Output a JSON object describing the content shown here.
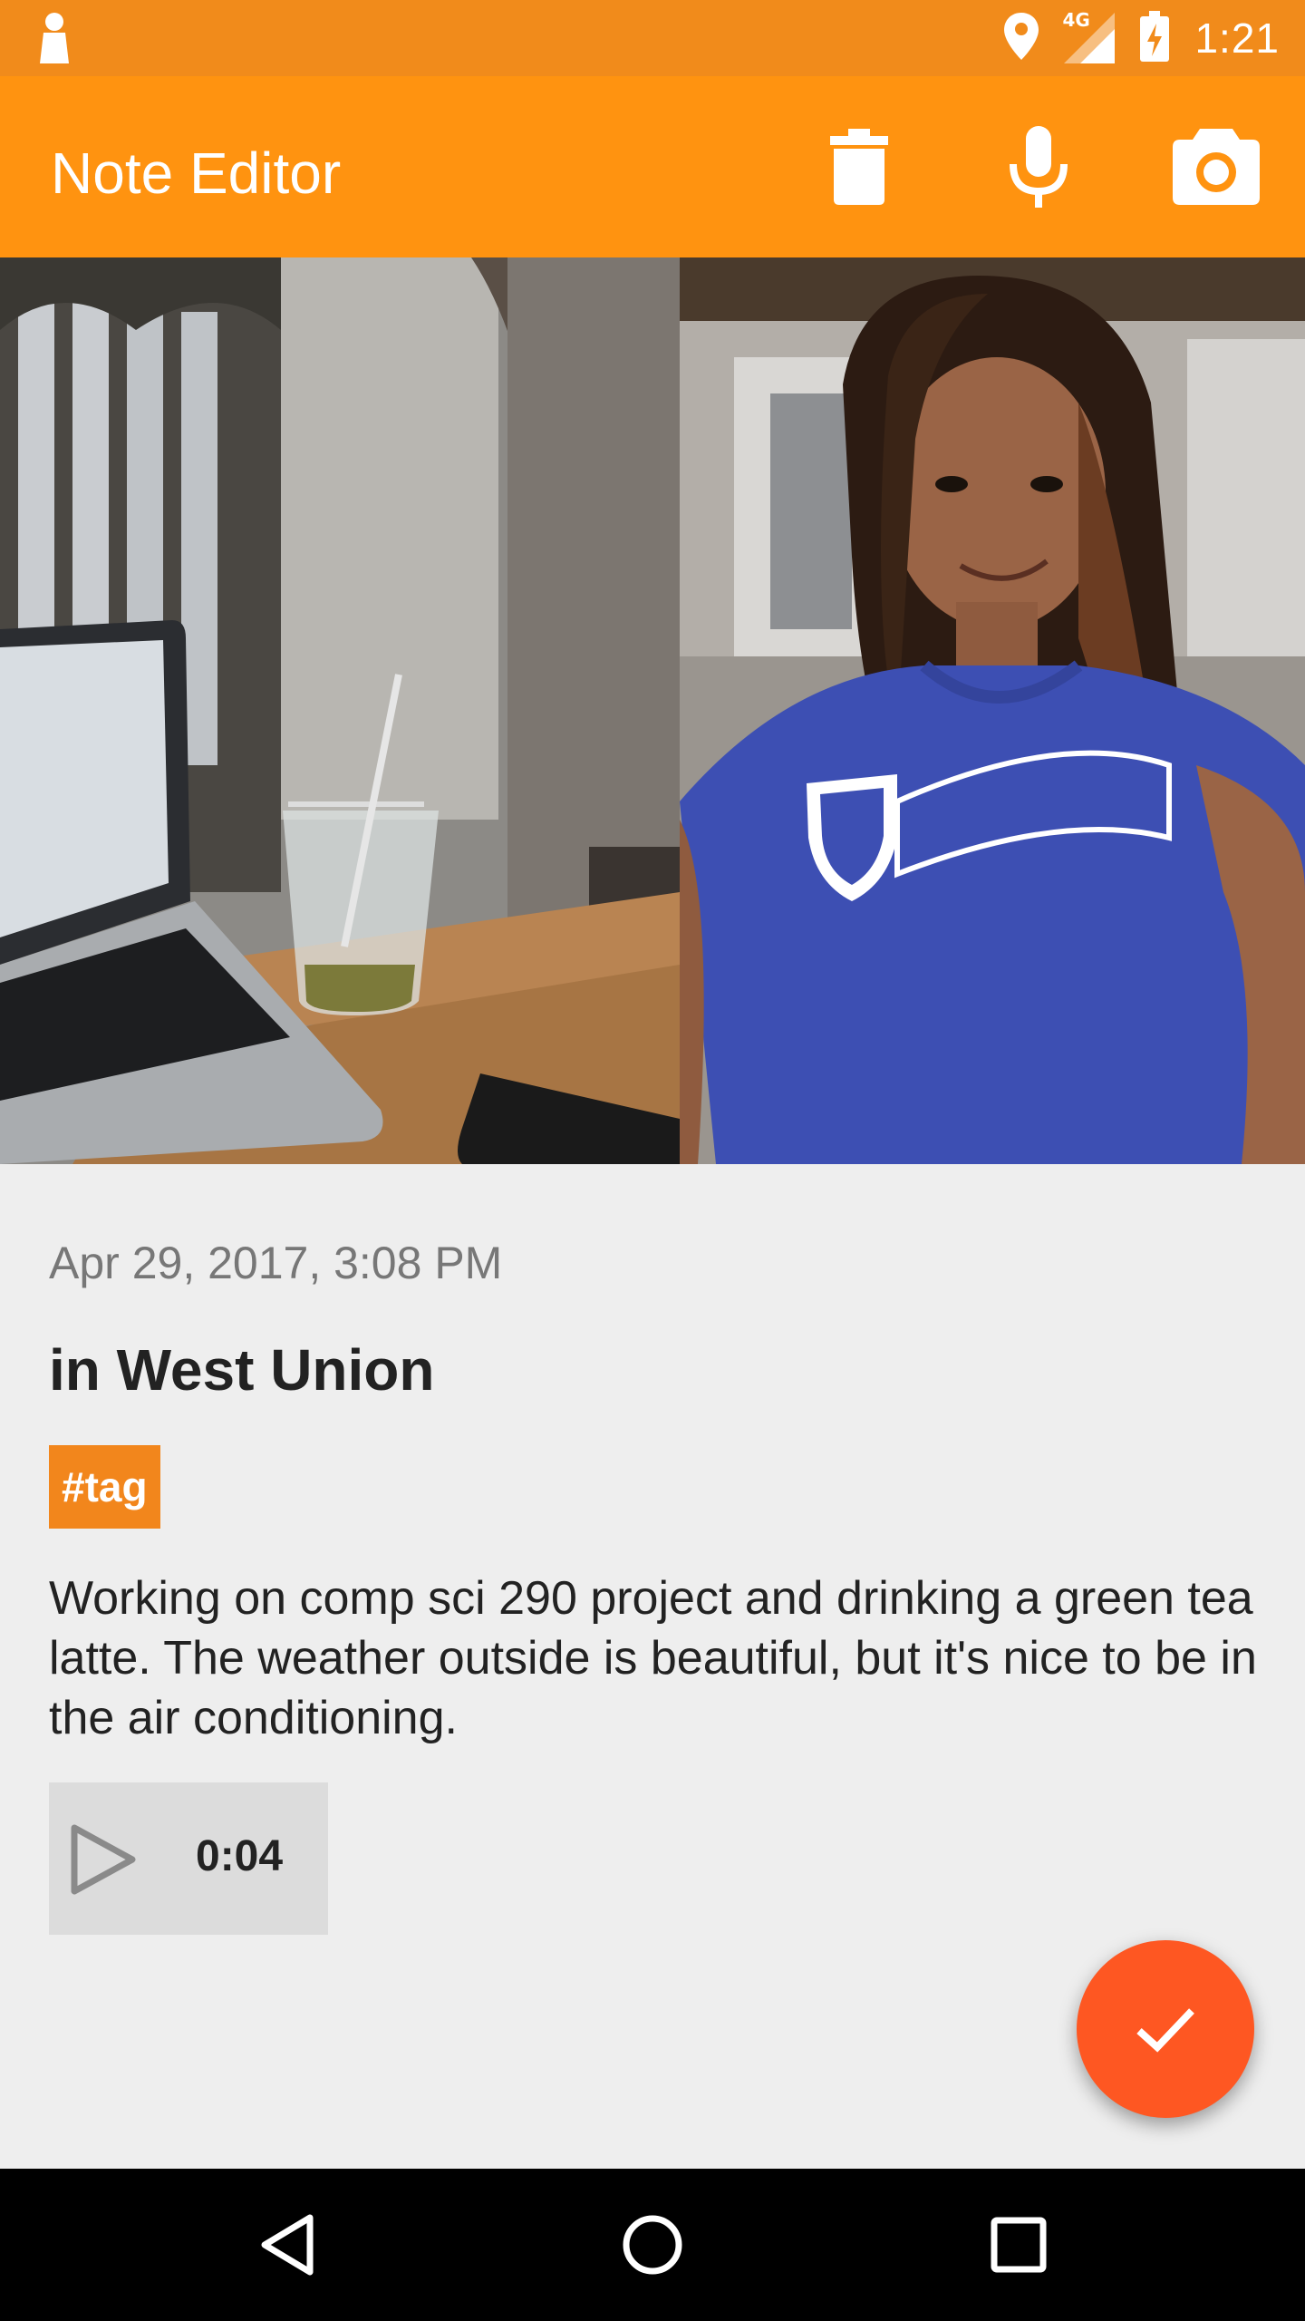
{
  "status_bar": {
    "network": "4G",
    "time": "1:21"
  },
  "app_bar": {
    "title": "Note Editor",
    "actions": [
      {
        "icon": "trash-icon"
      },
      {
        "icon": "microphone-icon"
      },
      {
        "icon": "camera-icon"
      }
    ]
  },
  "photos": [
    {
      "subject": "laptop and iced green tea latte on wooden table"
    },
    {
      "subject": "selfie in blue Duke t-shirt"
    }
  ],
  "note": {
    "date": "Apr 29, 2017, 3:08 PM",
    "title": "in West Union",
    "tag": "#tag",
    "body": "Working on comp sci 290 project and drinking a green tea latte. The weather outside is beautiful, but it's nice to be in the air conditioning.",
    "audio_duration": "0:04"
  },
  "colors": {
    "status_bar": "#f18b1b",
    "app_bar": "#ff9310",
    "tag": "#f2861c",
    "fab": "#fe5722",
    "background": "#eeeeee"
  },
  "fab_icon": "check-icon",
  "nav_bar": [
    "back-icon",
    "home-icon",
    "recents-icon"
  ]
}
